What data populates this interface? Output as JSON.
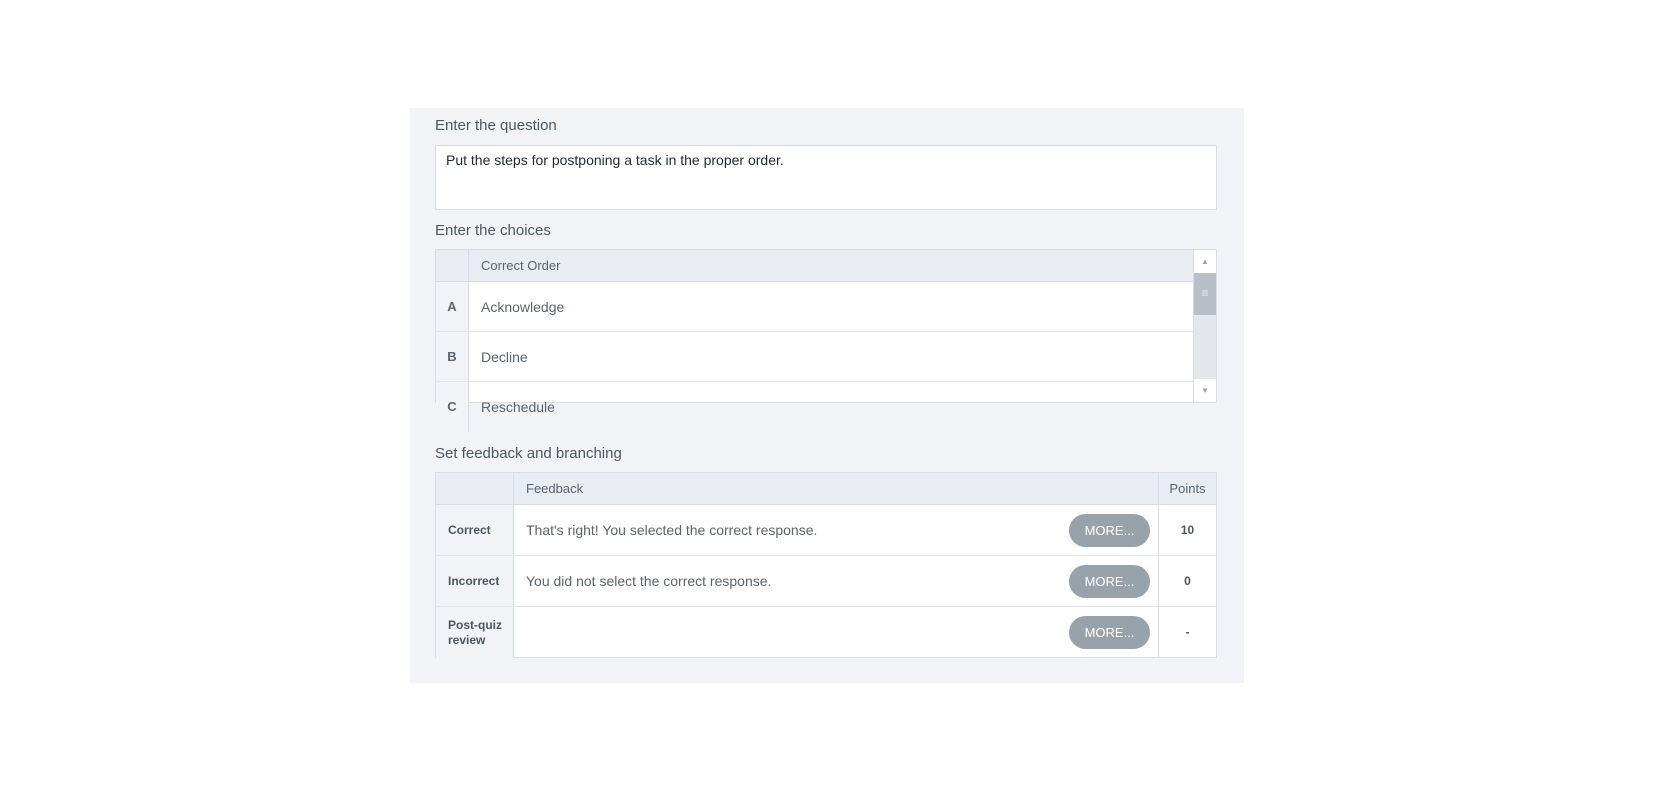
{
  "question_section": {
    "label": "Enter the question",
    "text": "Put the steps for postponing a task in the proper order."
  },
  "choices_section": {
    "label": "Enter the choices",
    "column_header": "Correct Order",
    "items": [
      {
        "letter": "A",
        "text": "Acknowledge"
      },
      {
        "letter": "B",
        "text": "Decline"
      },
      {
        "letter": "C",
        "text": "Reschedule"
      }
    ]
  },
  "feedback_section": {
    "label": "Set feedback and branching",
    "feedback_header": "Feedback",
    "points_header": "Points",
    "rows": [
      {
        "name": "Correct",
        "feedback": "That's right!  You selected the correct response.",
        "button": "MORE...",
        "points": "10"
      },
      {
        "name": "Incorrect",
        "feedback": "You did not select the correct response.",
        "button": "MORE...",
        "points": "0"
      },
      {
        "name": "Post-quiz review",
        "feedback": "",
        "button": "MORE...",
        "points": "-"
      }
    ]
  },
  "icons": {
    "scroll_up": "triangle-up",
    "scroll_down": "triangle-down",
    "scroll_thumb": "grip-lines"
  }
}
